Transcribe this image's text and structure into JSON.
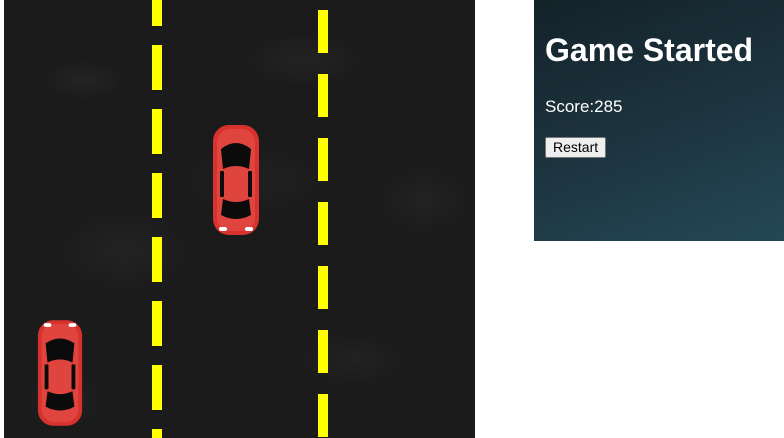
{
  "panel": {
    "title": "Game Started",
    "score_label": "Score:",
    "score_value": "285",
    "restart_label": "Restart"
  },
  "colors": {
    "road": "#1b1b1b",
    "lane_line": "#ffff00",
    "car_body": "#d7322d",
    "panel_gradient_start": "#142229",
    "panel_gradient_end": "#244857"
  },
  "icons": {
    "car": "red-car-icon"
  }
}
